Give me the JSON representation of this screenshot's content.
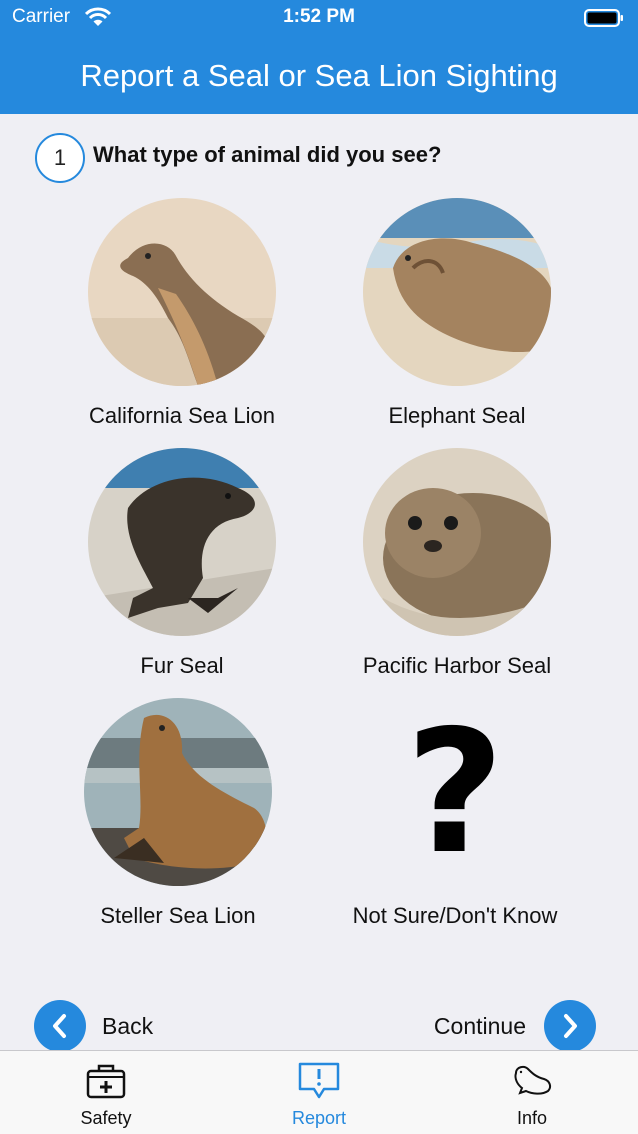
{
  "status_bar": {
    "carrier": "Carrier",
    "time": "1:52 PM"
  },
  "header": {
    "title": "Report a Seal or Sea Lion Sighting"
  },
  "question": {
    "number": "1",
    "text": "What type of animal did you see?"
  },
  "animals": [
    {
      "label": "California Sea Lion"
    },
    {
      "label": "Elephant Seal"
    },
    {
      "label": "Fur Seal"
    },
    {
      "label": "Pacific Harbor Seal"
    },
    {
      "label": "Steller Sea Lion"
    },
    {
      "label": "Not Sure/Don't Know"
    }
  ],
  "unknown_symbol": "?",
  "navigation": {
    "back_label": "Back",
    "continue_label": "Continue"
  },
  "tabbar": {
    "items": [
      {
        "label": "Safety",
        "icon": "first-aid-kit-icon"
      },
      {
        "label": "Report",
        "icon": "report-speech-bubble-icon",
        "active": true
      },
      {
        "label": "Info",
        "icon": "seal-icon"
      }
    ]
  },
  "colors": {
    "accent": "#2589dd",
    "background": "#efeff4",
    "tabbar": "#f8f8f8"
  }
}
